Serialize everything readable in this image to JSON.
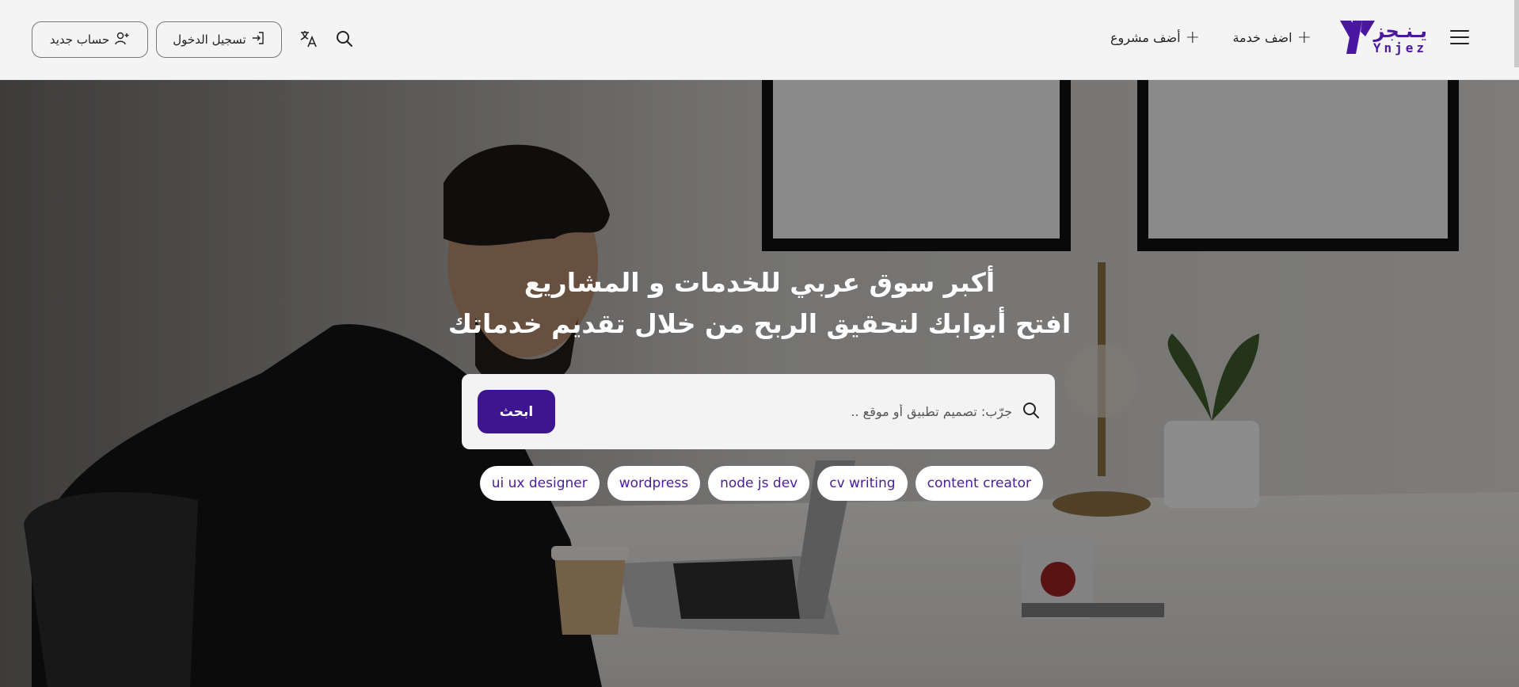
{
  "brand": {
    "arabic": "يـنـجز",
    "latin": "Ynjez",
    "color": "#4a17a2"
  },
  "nav": {
    "add_service": "اضف خدمة",
    "add_project": "أضف مشروع",
    "login": "تسجيل الدخول",
    "register": "حساب جديد"
  },
  "icons": {
    "menu": "hamburger-icon",
    "search": "search-icon",
    "language": "translate-icon",
    "login": "sign-in-icon",
    "register": "user-plus-icon"
  },
  "hero": {
    "line1": "أكبر سوق عربي للخدمات و المشاريع",
    "line2": "افتح أبوابك لتحقيق الربح من خلال تقديم خدماتك",
    "search_placeholder": "جرّب: تصميم تطبيق أو موقع ..",
    "search_button": "ابحث",
    "tags": [
      "ui ux designer",
      "wordpress",
      "node js dev",
      "cv writing",
      "content creator"
    ]
  },
  "colors": {
    "accent": "#3e1591",
    "tag_text": "#4b1c9e"
  }
}
